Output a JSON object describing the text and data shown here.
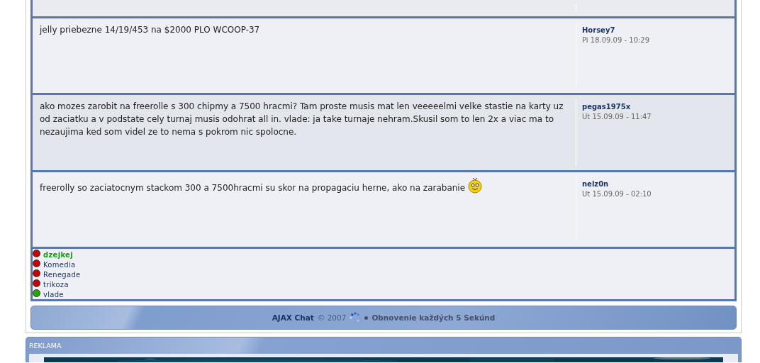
{
  "messages": [
    {
      "has_smiley": false
    },
    {
      "text": "jelly priebezne 14/19/453 na $2000 PLO WCOOP-37",
      "author": "Horsey7",
      "time": "Pi 18.09.09 - 10:29",
      "has_smiley": false
    },
    {
      "text": "ako mozes zarobit na freerolle s 300 chipmy a 7500 hracmi? Tam proste musis mat len veeeeelmi velke stastie na karty uz od zaciatku a v podstate cely turnaj musis odohrat all in. vlade: ja take turnaje nehram.Skusil som to len 2x a viac ma to nezaujima ked som videl ze to nema s pokrom nic spolocne.",
      "author": "pegas1975x",
      "time": "Ut 15.09.09 - 11:47",
      "has_smiley": false
    },
    {
      "text": "freerolly so zaciatocnym stackom 300 a 7500hracmi su skor na propagaciu herne, ako na zarabanie",
      "author": "nelz0n",
      "time": "Ut 15.09.09 - 02:10",
      "has_smiley": true
    }
  ],
  "users": [
    {
      "name": "dzejkej",
      "color": "#cc0000",
      "highlighted": true
    },
    {
      "name": "Komedia",
      "color": "#cc0000",
      "highlighted": false
    },
    {
      "name": "Renegade",
      "color": "#cc0000",
      "highlighted": false
    },
    {
      "name": "trikoza",
      "color": "#cc0000",
      "highlighted": false
    },
    {
      "name": "vlade",
      "color": "#22aa00",
      "highlighted": false
    }
  ],
  "footer": {
    "product": "AJAX Chat",
    "copyright": "© 2007",
    "refresh": "Obnovenie každých 5 Sekúnd"
  },
  "ad_panel": {
    "title": "REKLAMA",
    "kind": "picture"
  }
}
